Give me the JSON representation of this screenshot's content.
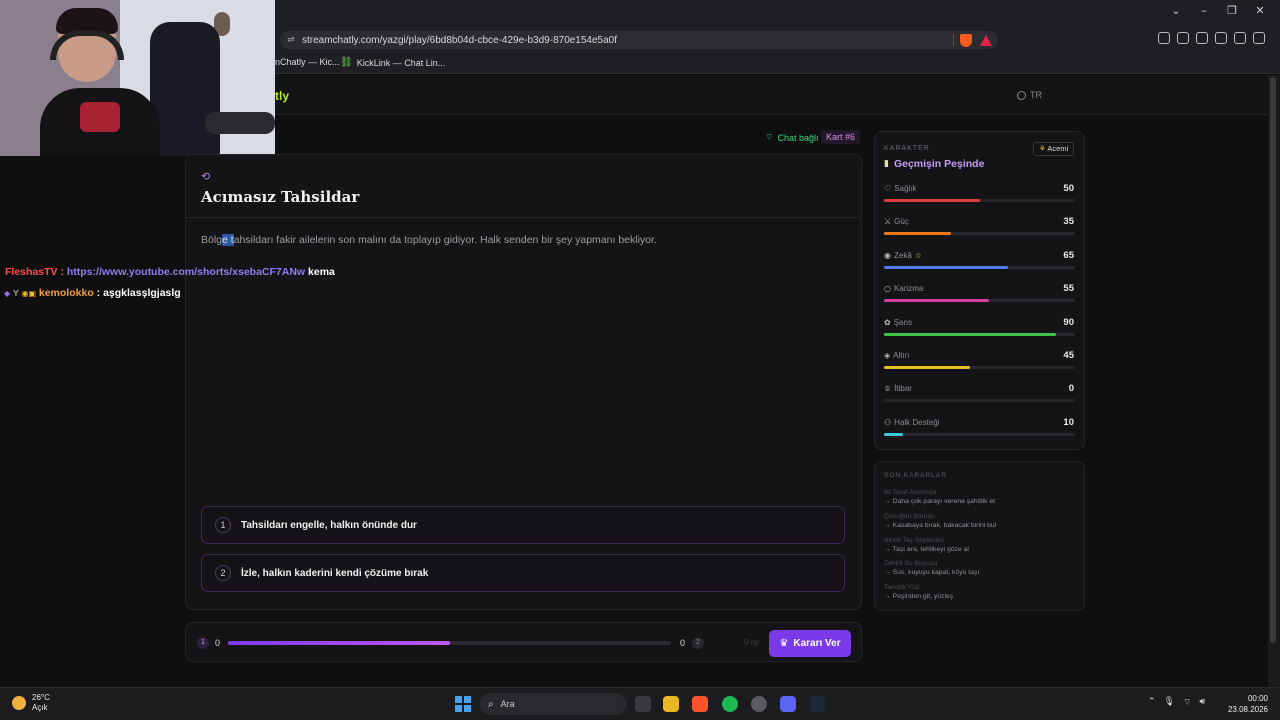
{
  "browser": {
    "url": "streamchatly.com/yazgi/play/6bd8b04d-cbce-429e-b3d9-870e154e5a0f",
    "bookmarks": [
      "nChatly — Kic...",
      "KickLink — Chat Lin..."
    ]
  },
  "site": {
    "logo_fragment": "tly",
    "language": "TR"
  },
  "status": {
    "chat": "Chat bağlı",
    "card": "Kart #6"
  },
  "card": {
    "title": "Acımasız Tahsildar",
    "text_before": "Bölg",
    "text_selected": "e t",
    "text_after": "ahsildarı fakir ailelerin son malını da toplayıp gidiyor. Halk senden bir şey yapmanı bekliyor.",
    "options": [
      {
        "num": "1",
        "label": "Tahsildarı engelle, halkın önünde dur"
      },
      {
        "num": "2",
        "label": "İzle, halkın kaderini kendi çözüme bırak"
      }
    ]
  },
  "vote": {
    "left_option": "1",
    "left_count": "0",
    "right_count": "0",
    "right_option": "2",
    "progress": 0.5,
    "timer": "0 oy",
    "button_label": "Kararı Ver"
  },
  "character": {
    "section_label": "KARAKTER",
    "name": "Geçmişin Peşinde",
    "level_badge": "Acemi",
    "stats": [
      {
        "label": "Sağlık",
        "icon": "heart-icon",
        "glyph": "♡",
        "value": 50,
        "color": "#e0383f"
      },
      {
        "label": "Güç",
        "icon": "sword-icon",
        "glyph": "⚔",
        "value": 35,
        "color": "#f07a1a"
      },
      {
        "label": "Zekâ",
        "icon": "brain-icon",
        "glyph": "◉",
        "value": 65,
        "color": "#4f7df0",
        "star": "☆"
      },
      {
        "label": "Karizma",
        "icon": "chat-bubble-icon",
        "glyph": "○",
        "value": 55,
        "color": "#d63fa0"
      },
      {
        "label": "Şans",
        "icon": "clover-icon",
        "glyph": "✿",
        "value": 90,
        "color": "#3ec44a"
      },
      {
        "label": "Altın",
        "icon": "coins-icon",
        "glyph": "◈",
        "value": 45,
        "color": "#e8c020"
      },
      {
        "label": "İtibar",
        "icon": "crown-icon",
        "glyph": "♕",
        "value": 0,
        "color": "#9a6ef0"
      },
      {
        "label": "Halk Desteği",
        "icon": "people-icon",
        "glyph": "⚇",
        "value": 10,
        "color": "#3ec8e0"
      }
    ]
  },
  "recent": {
    "title": "SON KARARLAR",
    "items": [
      {
        "name": "İki Taraf Arasında",
        "choice": "→ Daha çok parayı verene şahitlik et"
      },
      {
        "name": "Çocuğun Sorusu",
        "choice": "→ Kasabaya bırak, bakacak birini bul"
      },
      {
        "name": "Sihirli Taş Söylentisi",
        "choice": "→ Taşı ara, tehlikeyi göze al"
      },
      {
        "name": "Zehirli Su Kuyusu",
        "choice": "→ Sus, kuyuyu kapat, köyü taşı"
      },
      {
        "name": "Tanıdık Yüz",
        "choice": "→ Peşinden git, yüzleş"
      }
    ]
  },
  "chat": [
    {
      "user": "FleshasTV",
      "sep": " : ",
      "link": "https://www.youtube.com/shorts/xsebaCF7ANw",
      "msg": " kema"
    },
    {
      "user": "kemolokko",
      "sep": " : ",
      "msg": "aşgklasşlgjaslg"
    }
  ],
  "taskbar": {
    "weather_temp": "26°C",
    "weather_desc": "Açık",
    "search_placeholder": "Ara",
    "time": "00:00",
    "date": "23.08.2026"
  }
}
